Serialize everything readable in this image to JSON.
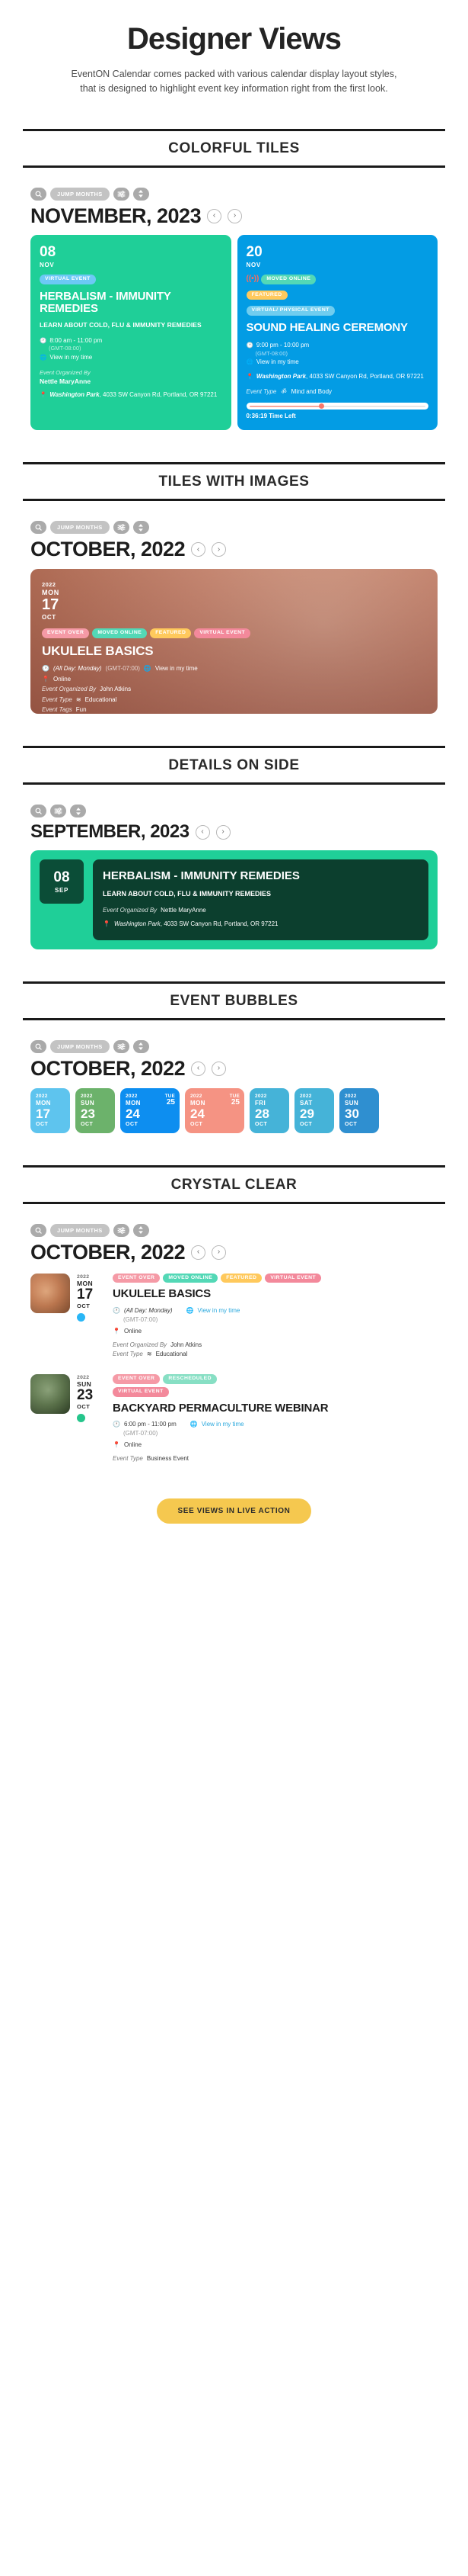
{
  "header": {
    "title": "Designer Views",
    "subtitle": "EventON Calendar comes packed with various calendar display layout styles, that is designed to highlight event key information right from the first look."
  },
  "toolbar": {
    "search_icon": "search-icon",
    "jump_months_label": "JUMP MONTHS",
    "filter_icon": "sliders-icon",
    "sort_icon": "sort-updown-icon",
    "prev_label": "‹",
    "next_label": "›"
  },
  "sections": [
    {
      "id": "colorful-tiles",
      "title": "COLORFUL TILES",
      "month": "NOVEMBER, 2023",
      "tiles": [
        {
          "color": "#1fcf98",
          "day": "08",
          "month": "NOV",
          "badges": [
            {
              "label": "VIRTUAL EVENT",
              "class": "bdg-virtual"
            }
          ],
          "title": "HERBALISM - IMMUNITY REMEDIES",
          "description": "LEARN ABOUT COLD, FLU & IMMUNITY REMEDIES",
          "time": "8:00 am - 11:00 pm",
          "timezone": "(GMT-08:00)",
          "view_in_my_time": "View in my time",
          "organizer_label": "Event Organized By",
          "organizer": "Nettle MaryAnne",
          "location_name": "Washington Park",
          "location_address": ", 4033 SW Canyon Rd, Portland, OR 97221"
        },
        {
          "color": "#039ce4",
          "day": "20",
          "month": "NOV",
          "live_icon": "live-broadcast-icon",
          "badges": [
            {
              "label": "MOVED ONLINE",
              "class": "bdg-moved"
            },
            {
              "label": "FEATURED",
              "class": "bdg-featured"
            },
            {
              "label": "VIRTUAL/ PHYSICAL EVENT",
              "class": "bdg-virtphys"
            }
          ],
          "title": "SOUND HEALING CEREMONY",
          "time": "9:00 pm - 10:00 pm",
          "timezone": "(GMT-08:00)",
          "view_in_my_time": "View in my time",
          "location_name": "Washington Park",
          "location_address": ", 4033 SW Canyon Rd, Portland, OR 97221",
          "event_type_label": "Event Type",
          "event_type_icon": "om-icon",
          "event_type": "Mind and Body",
          "countdown": "0:36:19 Time Left",
          "countdown_percent": 41
        }
      ]
    },
    {
      "id": "tiles-with-images",
      "title": "TILES WITH IMAGES",
      "month": "OCTOBER, 2022",
      "image_tile": {
        "year": "2022",
        "dow": "MON",
        "day": "17",
        "month": "OCT",
        "badges": [
          {
            "label": "EVENT OVER",
            "class": "bdg-over"
          },
          {
            "label": "MOVED ONLINE",
            "class": "bdg-edu"
          },
          {
            "label": "FEATURED",
            "class": "bdg-featured"
          },
          {
            "label": "VIRTUAL EVENT",
            "class": "bdg-vevent"
          }
        ],
        "title": "UKULELE BASICS",
        "time": "(All Day: Monday)",
        "timezone": "(GMT-07:00)",
        "view_in_my_time": "View in my time",
        "location": "Online",
        "organizer_label": "Event Organized By",
        "organizer": "John Atkins",
        "event_type_label": "Event Type",
        "event_type": "Educational",
        "event_tags_label": "Event Tags",
        "event_tags": "Fun"
      }
    },
    {
      "id": "details-on-side",
      "title": "DETAILS ON SIDE",
      "month": "SEPTEMBER, 2023",
      "card": {
        "day": "08",
        "month": "SEP",
        "title": "HERBALISM - IMMUNITY REMEDIES",
        "description": "LEARN ABOUT COLD, FLU & IMMUNITY REMEDIES",
        "organizer_label": "Event Organized By",
        "organizer": "Nettle MaryAnne",
        "location_name": "Washington Park",
        "location_address": ", 4033 SW Canyon Rd, Portland, OR 97221"
      }
    },
    {
      "id": "event-bubbles",
      "title": "EVENT BUBBLES",
      "month": "OCTOBER, 2022",
      "bubbles": [
        {
          "year": "2022",
          "dow": "MON",
          "day": "17",
          "month": "OCT",
          "color": "#5ec4ee"
        },
        {
          "year": "2022",
          "dow": "SUN",
          "day": "23",
          "month": "OCT",
          "color": "#6cb26b"
        },
        {
          "year": "2022",
          "dow": "MON",
          "day": "24",
          "month": "OCT",
          "color": "#0d8ef0",
          "end_dow": "TUE",
          "end_day": "25"
        },
        {
          "year": "2022",
          "dow": "MON",
          "day": "24",
          "month": "OCT",
          "color": "#f59383",
          "end_dow": "TUE",
          "end_day": "25"
        },
        {
          "year": "2022",
          "dow": "FRI",
          "day": "28",
          "month": "OCT",
          "color": "#45b3d8"
        },
        {
          "year": "2022",
          "dow": "SAT",
          "day": "29",
          "month": "OCT",
          "color": "#45b3d8"
        },
        {
          "year": "2022",
          "dow": "SUN",
          "day": "30",
          "month": "OCT",
          "color": "#2f8fd0"
        }
      ]
    },
    {
      "id": "crystal-clear",
      "title": "CRYSTAL CLEAR",
      "month": "OCTOBER, 2022",
      "rows": [
        {
          "year": "2022",
          "dow": "MON",
          "day": "17",
          "month": "OCT",
          "dot_color": "#29b6f6",
          "badges": [
            {
              "label": "EVENT OVER",
              "class": "bdg-over"
            },
            {
              "label": "MOVED ONLINE",
              "class": "bdg-edu"
            },
            {
              "label": "FEATURED",
              "class": "bdg-featured"
            },
            {
              "label": "VIRTUAL EVENT",
              "class": "bdg-vevent"
            }
          ],
          "title": "UKULELE BASICS",
          "time": "(All Day: Monday)",
          "timezone": "(GMT-07:00)",
          "view_in_my_time": "View in my time",
          "location": "Online",
          "organizer_label": "Event Organized By",
          "organizer": "John Atkins",
          "event_type_label": "Event Type",
          "event_type": "Educational"
        },
        {
          "year": "2022",
          "dow": "SUN",
          "day": "23",
          "month": "OCT",
          "dot_color": "#25c58b",
          "badges": [
            {
              "label": "EVENT OVER",
              "class": "bdg-over"
            },
            {
              "label": "RESCHEDULED",
              "class": "bdg-resched"
            },
            {
              "label": "VIRTUAL EVENT",
              "class": "bdg-vevent"
            }
          ],
          "title": "BACKYARD PERMACULTURE WEBINAR",
          "time": "6:00 pm - 11:00 pm",
          "timezone": "(GMT-07:00)",
          "view_in_my_time": "View in my time",
          "location": "Online",
          "event_type_label": "Event Type",
          "event_type": "Business Event"
        }
      ]
    }
  ],
  "cta": {
    "label": "SEE VIEWS IN LIVE ACTION"
  }
}
